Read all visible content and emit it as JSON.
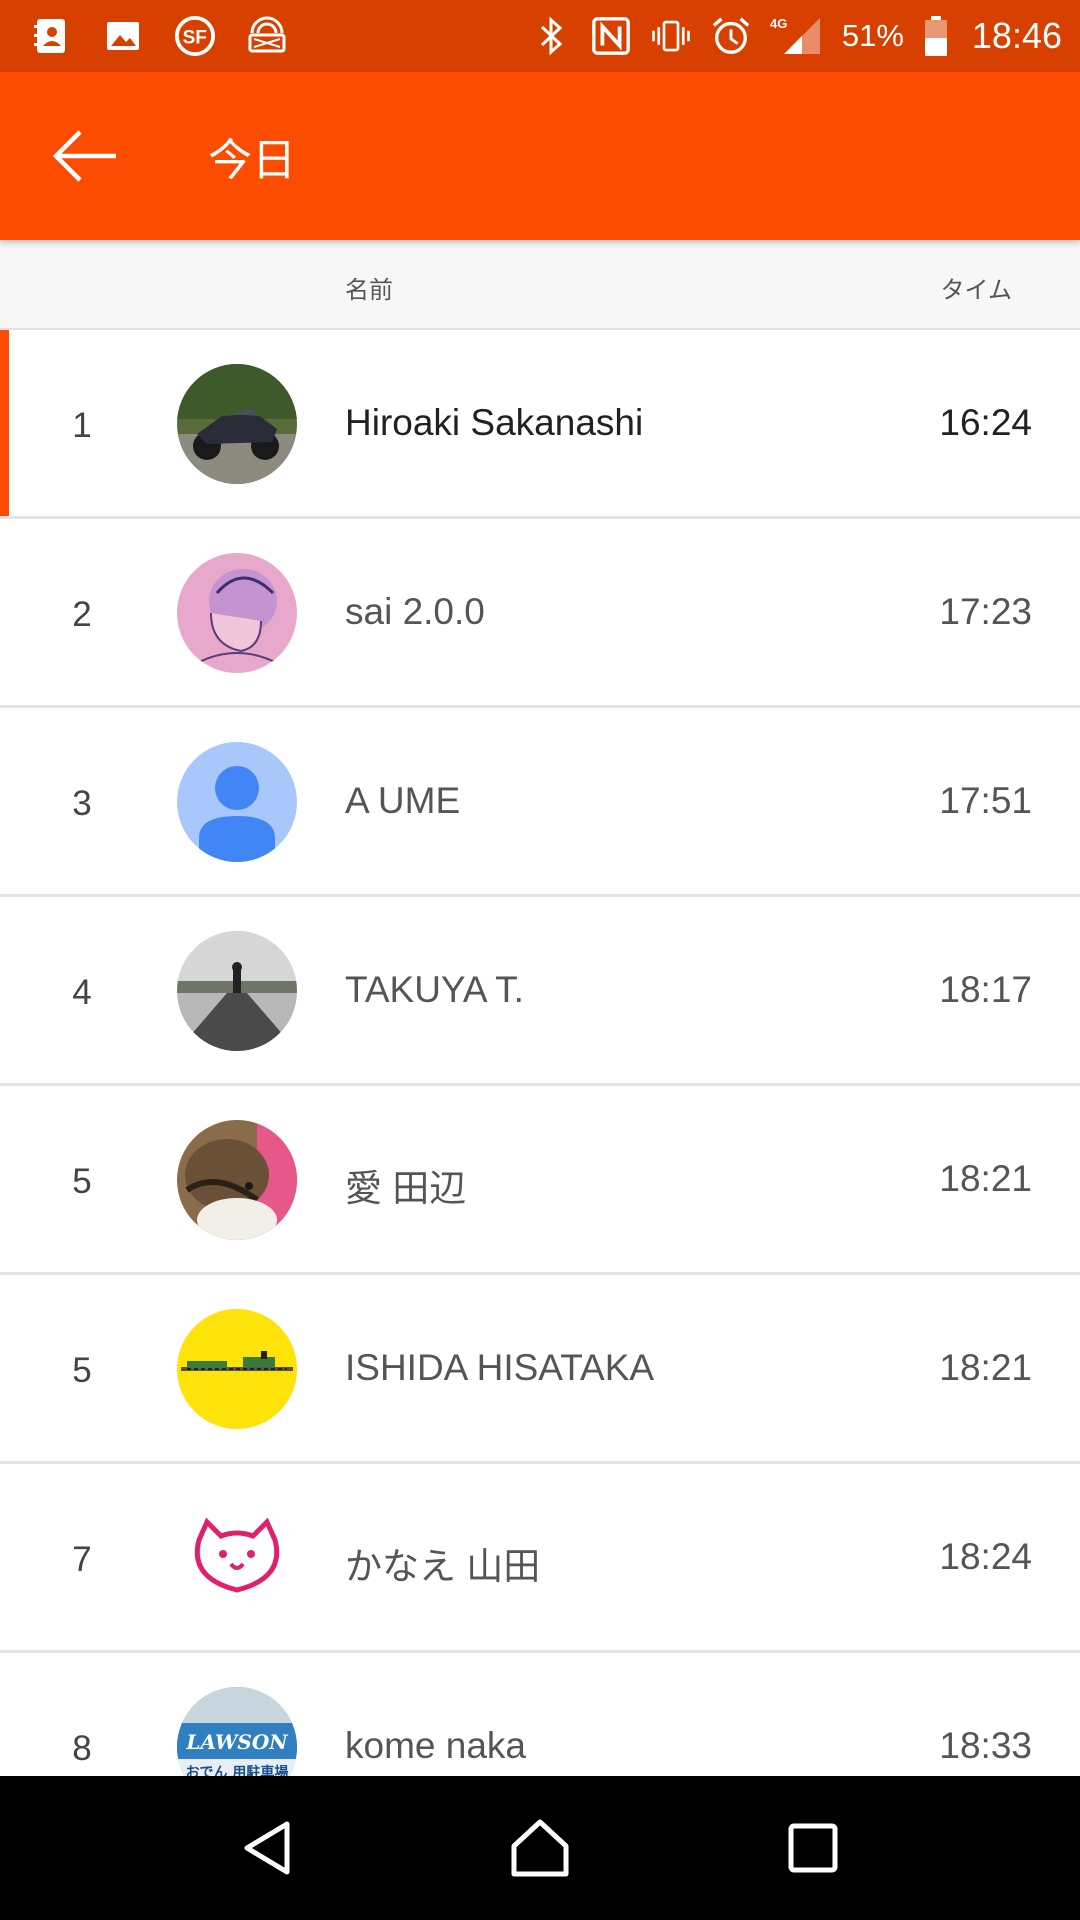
{
  "status_bar": {
    "battery": "51%",
    "time": "18:46",
    "network": "4G"
  },
  "app_bar": {
    "title": "今日",
    "back_icon": "arrow-back-icon"
  },
  "columns": {
    "name": "名前",
    "time": "タイム"
  },
  "leaderboard": [
    {
      "rank": "1",
      "name": "Hiroaki Sakanashi",
      "time": "16:24",
      "highlighted": true
    },
    {
      "rank": "2",
      "name": "sai 2.0.0",
      "time": "17:23"
    },
    {
      "rank": "3",
      "name": "A UME",
      "time": "17:51"
    },
    {
      "rank": "4",
      "name": "TAKUYA T.",
      "time": "18:17"
    },
    {
      "rank": "5",
      "name": "愛 田辺",
      "time": "18:21"
    },
    {
      "rank": "5",
      "name": "ISHIDA HISATAKA",
      "time": "18:21"
    },
    {
      "rank": "7",
      "name": "かなえ 山田",
      "time": "18:24"
    },
    {
      "rank": "8",
      "name": "kome naka",
      "time": "18:33"
    }
  ],
  "avatar_7_text": "LAWSON",
  "avatar_7_subtext": "おでん 用駐車場",
  "colors": {
    "status_bar": "#d84000",
    "app_bar": "#fc4c02",
    "highlight": "#fc4c02"
  }
}
